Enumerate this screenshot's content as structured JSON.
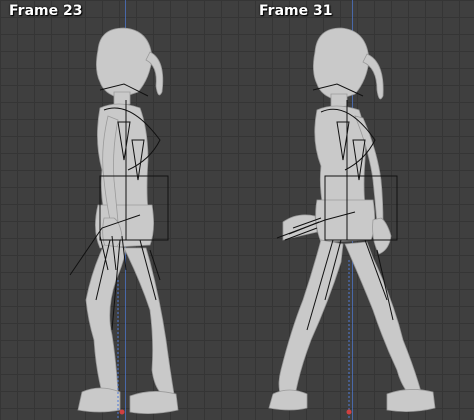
{
  "panels": [
    {
      "label": "Frame 23"
    },
    {
      "label": "Frame 31"
    }
  ],
  "colors": {
    "background": "#3f3f3f",
    "grid": "#353535",
    "model": "#c9c9c9",
    "rig_lines": "#111111",
    "axis_blue": "#4f7bd6",
    "axis_red": "#d04040"
  }
}
